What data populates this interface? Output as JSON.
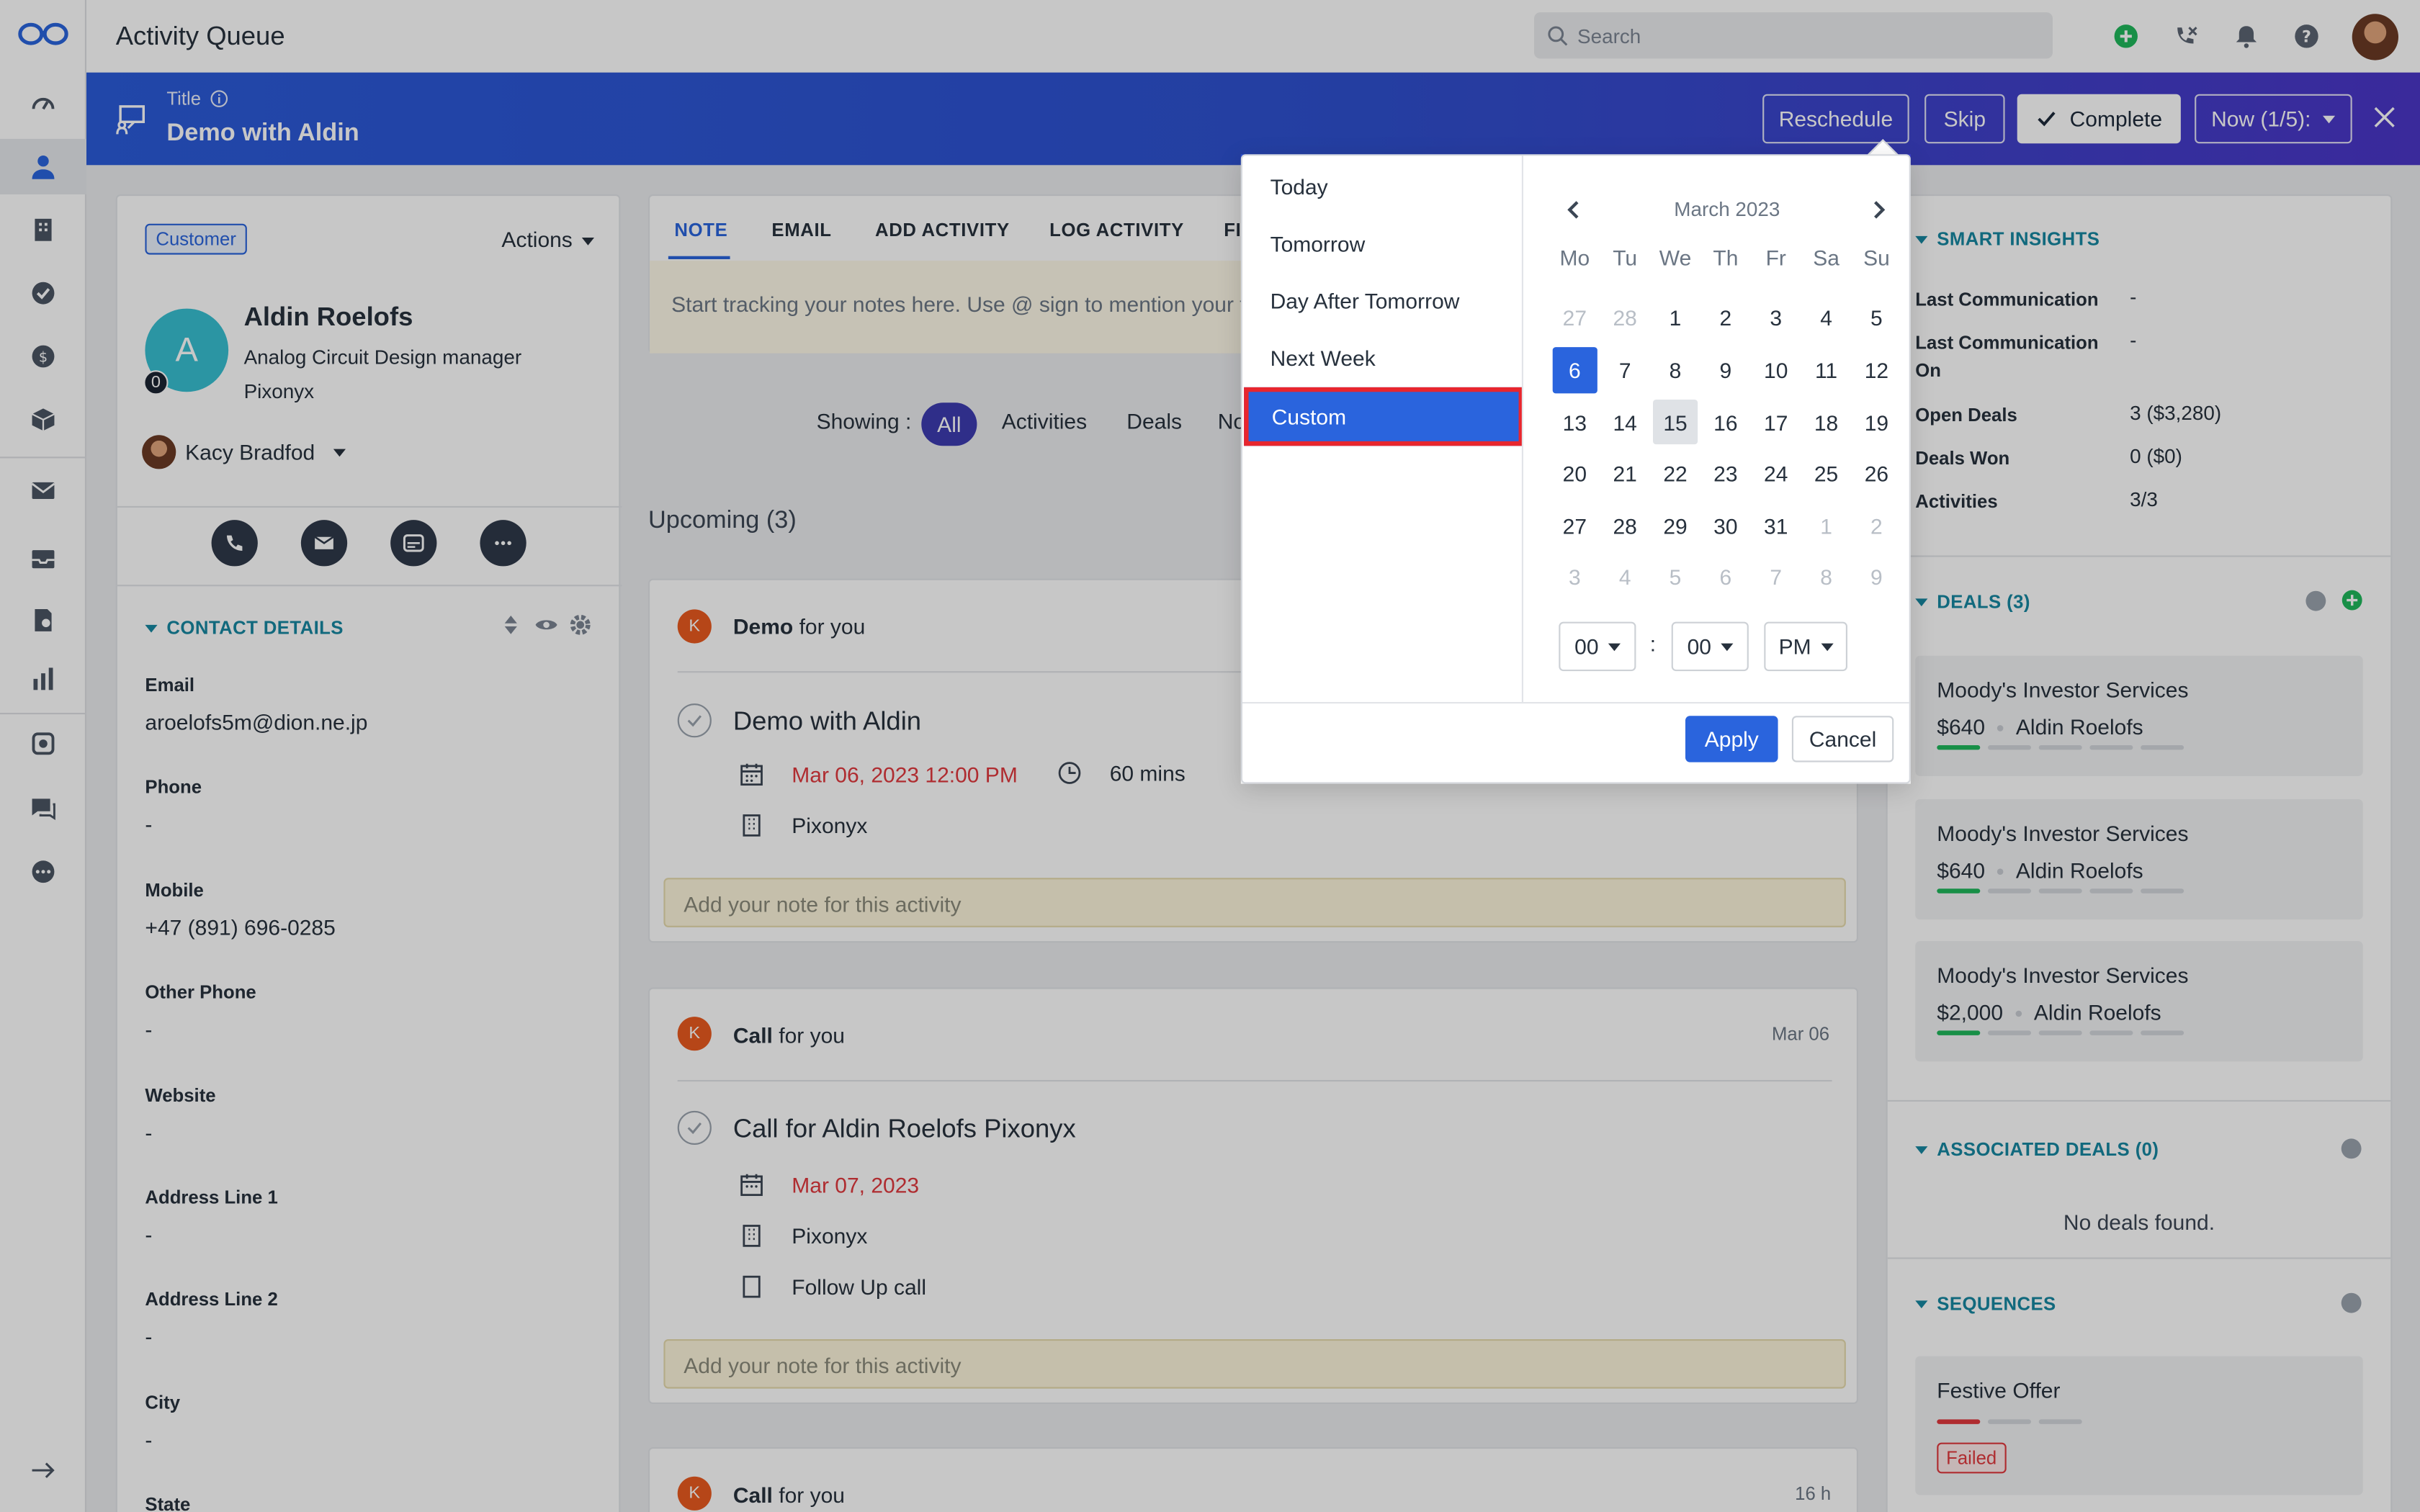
{
  "topbar": {
    "title": "Activity Queue",
    "search_placeholder": "Search"
  },
  "banner": {
    "label": "Title",
    "title": "Demo with Aldin",
    "reschedule": "Reschedule",
    "skip": "Skip",
    "complete": "Complete",
    "now": "Now (1/5):"
  },
  "contact": {
    "badge": "Customer",
    "actions": "Actions",
    "initial": "A",
    "badge_count": "0",
    "name": "Aldin Roelofs",
    "role": "Analog Circuit Design manager",
    "company": "Pixonyx",
    "owner": "Kacy Bradfod",
    "section_title": "CONTACT DETAILS",
    "fields": [
      {
        "label": "Email",
        "value": "aroelofs5m@dion.ne.jp"
      },
      {
        "label": "Phone",
        "value": "-"
      },
      {
        "label": "Mobile",
        "value": "+47 (891) 696-0285"
      },
      {
        "label": "Other Phone",
        "value": "-"
      },
      {
        "label": "Website",
        "value": "-"
      },
      {
        "label": "Address Line 1",
        "value": "-"
      },
      {
        "label": "Address Line 2",
        "value": "-"
      },
      {
        "label": "City",
        "value": "-"
      },
      {
        "label": "State",
        "value": ""
      }
    ]
  },
  "tabs": [
    "NOTE",
    "EMAIL",
    "ADD ACTIVITY",
    "LOG ACTIVITY",
    "FI"
  ],
  "note_placeholder": "Start tracking your notes here. Use @ sign to mention your te",
  "filter": {
    "showing": "Showing :",
    "all": "All",
    "activities": "Activities",
    "deals": "Deals",
    "notes": "No"
  },
  "upcoming": "Upcoming (3)",
  "activities": [
    {
      "avatar": "K",
      "type": "Demo",
      "for": "for you",
      "date": "",
      "title": "Demo with Aldin",
      "when": "Mar 06, 2023 12:00 PM",
      "duration": "60 mins",
      "company": "Pixonyx",
      "note_placeholder": "Add your note for this activity"
    },
    {
      "avatar": "K",
      "type": "Call",
      "for": "for you",
      "date": "Mar 06",
      "title": "Call for Aldin Roelofs Pixonyx",
      "when": "Mar 07, 2023",
      "company": "Pixonyx",
      "subject": "Follow Up call",
      "note_placeholder": "Add your note for this activity"
    },
    {
      "avatar": "K",
      "type": "Call",
      "for": "for you",
      "date": "16 h"
    }
  ],
  "insights": {
    "title": "SMART INSIGHTS",
    "rows": [
      {
        "label": "Last Communication",
        "value": "-"
      },
      {
        "label": "Last Communication On",
        "value": "-"
      },
      {
        "label": "Open Deals",
        "value": "3 ($3,280)"
      },
      {
        "label": "Deals Won",
        "value": "0 ($0)"
      },
      {
        "label": "Activities",
        "value": "3/3"
      }
    ]
  },
  "deals": {
    "title": "DEALS (3)",
    "items": [
      {
        "name": "Moody's Investor Services",
        "amount": "$640",
        "owner": "Aldin Roelofs"
      },
      {
        "name": "Moody's Investor Services",
        "amount": "$640",
        "owner": "Aldin Roelofs"
      },
      {
        "name": "Moody's Investor Services",
        "amount": "$2,000",
        "owner": "Aldin Roelofs"
      }
    ]
  },
  "associated": {
    "title": "ASSOCIATED DEALS (0)",
    "empty": "No deals found."
  },
  "sequences": {
    "title": "SEQUENCES",
    "item": "Festive Offer",
    "status": "Failed"
  },
  "reschedule_popup": {
    "quick_options": [
      "Today",
      "Tomorrow",
      "Day After Tomorrow",
      "Next Week"
    ],
    "custom": "Custom",
    "month": "March 2023",
    "weekdays": [
      "Mo",
      "Tu",
      "We",
      "Th",
      "Fr",
      "Sa",
      "Su"
    ],
    "days": [
      [
        "27",
        "28",
        "1",
        "2",
        "3",
        "4",
        "5"
      ],
      [
        "6",
        "7",
        "8",
        "9",
        "10",
        "11",
        "12"
      ],
      [
        "13",
        "14",
        "15",
        "16",
        "17",
        "18",
        "19"
      ],
      [
        "20",
        "21",
        "22",
        "23",
        "24",
        "25",
        "26"
      ],
      [
        "27",
        "28",
        "29",
        "30",
        "31",
        "1",
        "2"
      ],
      [
        "3",
        "4",
        "5",
        "6",
        "7",
        "8",
        "9"
      ]
    ],
    "selected_day": "6",
    "today_day": "15",
    "hour": "00",
    "separator": ":",
    "minute": "00",
    "ampm": "PM",
    "apply": "Apply",
    "cancel": "Cancel"
  },
  "colors": {
    "accent": "#2a64dd",
    "banner_start": "#2b5bd9",
    "banner_end": "#4b36c7",
    "teal": "#1687a0",
    "red": "#e0393e",
    "green": "#1fb85c"
  }
}
